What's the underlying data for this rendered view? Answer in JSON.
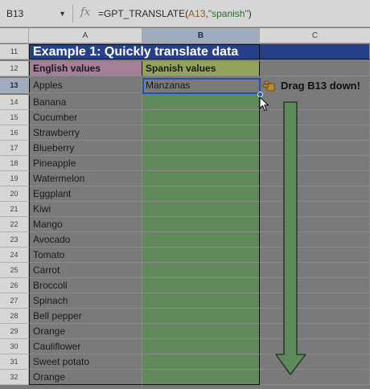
{
  "formula_bar": {
    "name_box": "B13",
    "fx": "fx",
    "formula_prefix": "=GPT_TRANSLATE(",
    "formula_ref": "A13",
    "formula_sep": ",",
    "formula_str": "\"spanish\"",
    "formula_close": ")"
  },
  "columns": [
    "A",
    "B",
    "C"
  ],
  "title": "Example 1: Quickly translate data",
  "headers": {
    "english": "English values",
    "spanish": "Spanish values"
  },
  "row_numbers": [
    "11",
    "12",
    "13",
    "14",
    "15",
    "16",
    "17",
    "18",
    "19",
    "20",
    "21",
    "22",
    "23",
    "24",
    "25",
    "26",
    "27",
    "28",
    "29",
    "30",
    "31",
    "32"
  ],
  "english_values": [
    "Apples",
    "Banana",
    "Cucumber",
    "Strawberry",
    "Blueberry",
    "Pineapple",
    "Watermelon",
    "Eggplant",
    "Kiwi",
    "Mango",
    "Avocado",
    "Tomato",
    "Carrot",
    "Broccoli",
    "Spinach",
    "Bell pepper",
    "Orange",
    "Cauliflower",
    "Sweet potato",
    "Orange"
  ],
  "spanish_values": [
    "Manzanas"
  ],
  "annotation": "Drag B13 down!",
  "icons": {
    "dropdown": "chevron-down-icon",
    "hand": "pointing-hand-icon",
    "cursor": "mouse-pointer-icon",
    "arrow": "down-arrow-icon"
  },
  "colors": {
    "title_bg": "#26408a",
    "english_header_bg": "#a37f98",
    "spanish_header_bg": "#93a35c",
    "fill_range_bg": "#5f8a5c",
    "selection": "#1a55b8"
  }
}
